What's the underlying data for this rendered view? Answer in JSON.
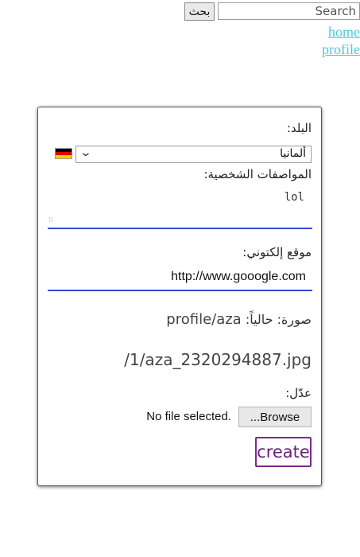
{
  "header": {
    "search_placeholder": "Search",
    "search_button": "بحث",
    "nav": {
      "home": "home",
      "profile": "profile"
    }
  },
  "form": {
    "country_label": "البلد:",
    "country_value": "ألمانيا",
    "country_flag": {
      "icon": "germany-flag-icon",
      "colors": [
        "#000000",
        "#dd0000",
        "#ffce00"
      ]
    },
    "profile_label": "المواصفات الشخصية:",
    "profile_value": "lol",
    "website_label": "موقع إلكتوني:",
    "website_value": "http://www.gooogle.com",
    "photo_label": "صورة:",
    "photo_current_label": "حالياً:",
    "photo_path": "profile/aza",
    "photo_file": "/1/aza_2320294887.jpg",
    "edit_label": "عدّل:",
    "browse_button": "Browse...",
    "file_status": "No file selected.",
    "create_button": "create"
  },
  "colors": {
    "nav_link": "#4fc9df",
    "field_underline": "#3b49d6",
    "create_border": "#7a2a8e"
  }
}
